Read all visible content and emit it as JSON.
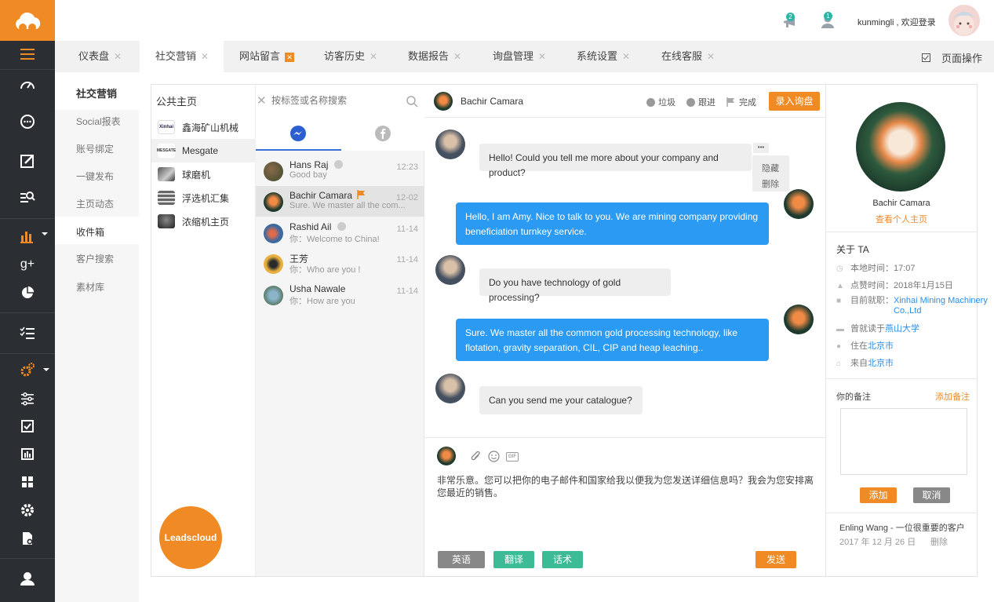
{
  "header": {
    "user": "kunmingli , 欢迎登录",
    "badge_a": "2",
    "badge_b": "1"
  },
  "tabs": [
    {
      "label": "仪表盘"
    },
    {
      "label": "社交营销"
    },
    {
      "label": "网站留言"
    },
    {
      "label": "访客历史"
    },
    {
      "label": "数据报告"
    },
    {
      "label": "询盘管理"
    },
    {
      "label": "系统设置"
    },
    {
      "label": "在线客服"
    }
  ],
  "page_ops": "页面操作",
  "subnav": {
    "title": "社交营销",
    "items": [
      "Social报表",
      "账号绑定",
      "一键发布",
      "主页动态",
      "收件箱",
      "客户搜索",
      "素材库"
    ]
  },
  "public_pages": {
    "title": "公共主页",
    "items": [
      {
        "label": "鑫海矿山机械",
        "tag": "Xinhai"
      },
      {
        "label": "Mesgate",
        "tag": "MESGATE"
      },
      {
        "label": "球磨机"
      },
      {
        "label": "浮选机汇集"
      },
      {
        "label": "浓缩机主页"
      }
    ]
  },
  "brand_button": "Leadscloud",
  "search": {
    "placeholder": "按标签或名称搜索"
  },
  "conversations": [
    {
      "name": "Hans Raj",
      "preview": "Good bay",
      "time": "12:23"
    },
    {
      "name": "Bachir  Camara",
      "preview": "Sure. We master all the com...",
      "time": "12-02"
    },
    {
      "name": "Rashid Ail",
      "preview": "你：Welcome to China!",
      "time": "11-14"
    },
    {
      "name": "王芳",
      "preview": "你：Who are you !",
      "time": "11-14"
    },
    {
      "name": "Usha Nawale",
      "preview": "你：How are you",
      "time": "11-14"
    }
  ],
  "chat": {
    "contact": "Bachir  Camara",
    "actions": {
      "spam": "垃圾",
      "follow": "跟进",
      "done": "完成",
      "record": "录入询盘"
    },
    "menu": {
      "more": "•••",
      "hide": "隐藏",
      "delete": "删除"
    },
    "messages": [
      {
        "dir": "in",
        "text": "Hello! Could you tell me more about your company and product?"
      },
      {
        "dir": "out",
        "text": "Hello, I am Amy. Nice to talk to you. We are mining company providing beneficiation turnkey service."
      },
      {
        "dir": "in",
        "text": "Do you have technology of gold processing?"
      },
      {
        "dir": "out",
        "text": "Sure. We master all the common gold processing technology, like flotation, gravity separation, CIL, CIP and heap leaching.."
      },
      {
        "dir": "in",
        "text": "Can you send me your catalogue?"
      }
    ],
    "composer_text": "非常乐意。您可以把你的电子邮件和国家给我以便我为您发送详细信息吗？我会为您安排离您最近的销售。",
    "gif": "GIF",
    "buttons": {
      "english": "英语",
      "translate": "翻译",
      "script": "话术",
      "send": "发送"
    }
  },
  "profile": {
    "name": "Bachir  Camara",
    "view_home": "查看个人主页",
    "about_title": "关于 TA",
    "local_time": "本地时间：17:07",
    "like_time": "点赞时间：2018年1月15日",
    "work_prefix": "目前就职：",
    "work_company": "Xinhai Mining Machinery Co.,Ltd",
    "edu_prefix": "曾就读于",
    "edu_school": "燕山大学",
    "live_prefix": "住在",
    "live_city": "北京市",
    "from_prefix": "来自",
    "from_city": "北京市",
    "note_title": "你的备注",
    "note_add": "添加备注",
    "add_btn": "添加",
    "cancel_btn": "取消",
    "note_entry": "Enling Wang - 一位很重要的客户",
    "note_date": "2017 年 12 月 26 日",
    "note_delete": "删除"
  },
  "colors": {
    "accent": "#f08a24",
    "blue": "#2b9af3",
    "green": "#3dbb96",
    "gray_btn": "#888888"
  }
}
